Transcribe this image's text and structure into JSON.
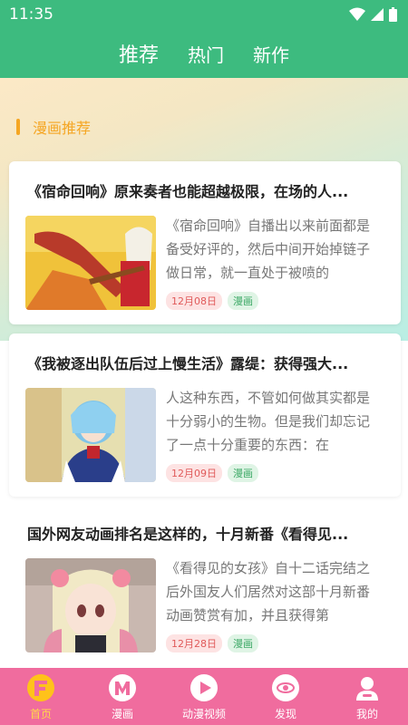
{
  "status_bar": {
    "time": "11:35"
  },
  "header": {
    "tabs": [
      {
        "label": "推荐"
      },
      {
        "label": "热门"
      },
      {
        "label": "新作"
      }
    ]
  },
  "section": {
    "title": "漫画推荐"
  },
  "articles": [
    {
      "title": "《宿命回响》原来奏者也能超越极限，在场的人...",
      "excerpt": "《宿命回响》自播出以来前面都是备受好评的，然后中间开始掉链子做日常，就一直处于被喷的",
      "date": "12月08日",
      "category": "漫画"
    },
    {
      "title": "《我被逐出队伍后过上慢生活》露缇：获得强大...",
      "excerpt": "人这种东西，不管如何做其实都是十分弱小的生物。但是我们却忘记了一点十分重要的东西：在",
      "date": "12月09日",
      "category": "漫画"
    },
    {
      "title": "国外网友动画排名是这样的，十月新番《看得见...",
      "excerpt": "《看得见的女孩》自十二话完结之后外国友人们居然对这部十月新番动画赞赏有加，并且获得第",
      "date": "12月28日",
      "category": "漫画"
    }
  ],
  "bottom_nav": [
    {
      "label": "首页"
    },
    {
      "label": "漫画"
    },
    {
      "label": "动漫视频"
    },
    {
      "label": "发现"
    },
    {
      "label": "我的"
    }
  ],
  "colors": {
    "primary": "#3dbb7f",
    "accent": "#f5a623",
    "nav": "#f06c9e",
    "nav_active": "#ffd84a"
  }
}
